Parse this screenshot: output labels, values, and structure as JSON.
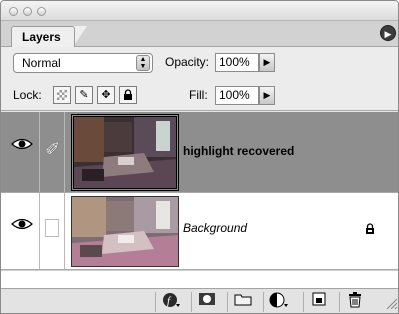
{
  "panel": {
    "tab_label": "Layers"
  },
  "options": {
    "blend_mode": "Normal",
    "opacity_label": "Opacity:",
    "opacity_value": "100%",
    "lock_label": "Lock:",
    "fill_label": "Fill:",
    "fill_value": "100%"
  },
  "layers": [
    {
      "name": "highlight recovered",
      "selected": true,
      "visible": true,
      "brush_icon": "paintbrush-icon"
    },
    {
      "name": "Background",
      "selected": false,
      "visible": true,
      "locked": true,
      "lock_icon": "lock-icon"
    }
  ],
  "bottom_buttons": [
    "add-layer-style-icon",
    "add-mask-icon",
    "new-group-icon",
    "new-adjustment-layer-icon",
    "new-layer-icon",
    "delete-layer-icon"
  ]
}
